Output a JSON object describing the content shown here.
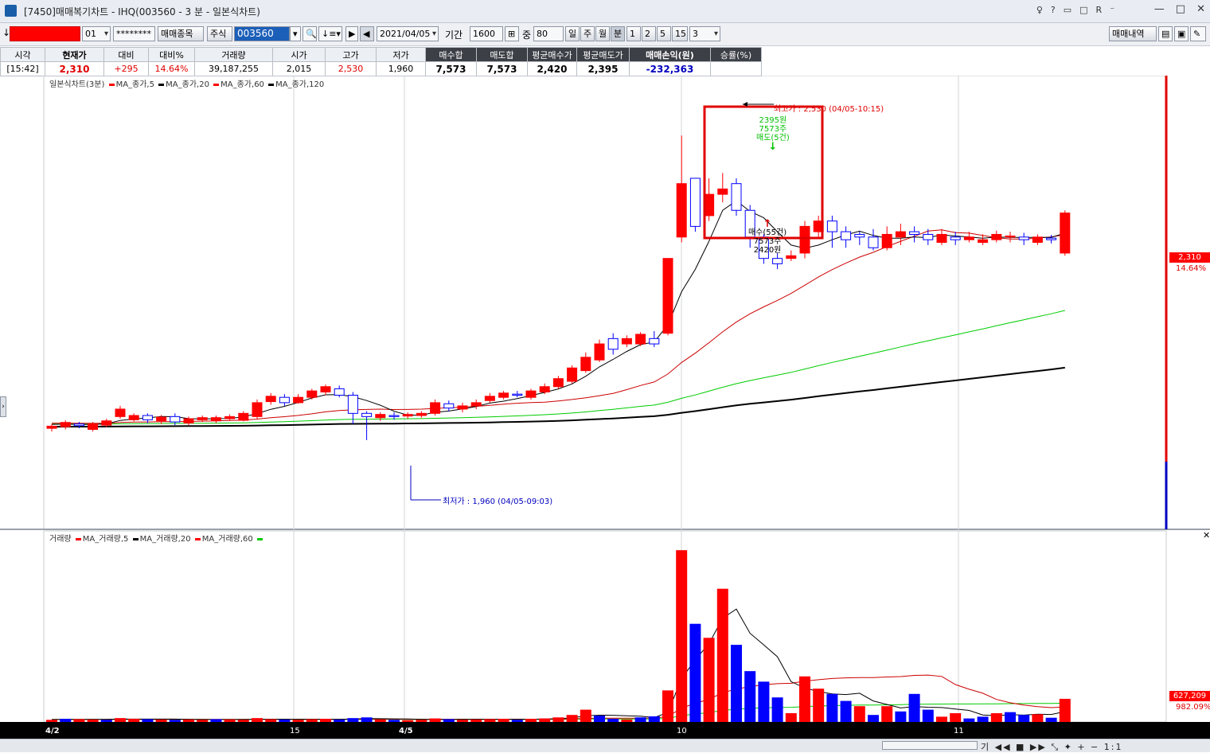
{
  "window": {
    "title": "[7450]매매복기차트 - IHQ(003560 - 3 분 - 일본식차트)",
    "small_buttons": [
      "♀",
      "?",
      "▭",
      "□",
      "R",
      "⁻"
    ],
    "controls": [
      "—",
      "□",
      "✕"
    ]
  },
  "toolbar": {
    "left_arrow": "↓",
    "account_suffix": "01",
    "password": "********",
    "trade_items_btn": "매매종목",
    "market": "주식",
    "code": "003560",
    "date": "2021/04/05",
    "period_label": "기간",
    "period_value": "1600",
    "mid_label": "중",
    "mid_value": "80",
    "tf_day": "일",
    "tf_week": "주",
    "tf_month": "월",
    "tf_min": "분",
    "tf_1": "1",
    "tf_2": "2",
    "tf_5": "5",
    "tf_15": "15",
    "tf_custom": "3",
    "history_btn": "매매내역"
  },
  "summary": {
    "headers": [
      "시각",
      "현재가",
      "대비",
      "대비%",
      "거래량",
      "시가",
      "고가",
      "저가",
      "매수합",
      "매도합",
      "평균매수가",
      "평균매도가",
      "매매손익(원)",
      "승률(%)"
    ],
    "values": [
      "[15:42]",
      "2,310",
      "+295",
      "14.64%",
      "39,187,255",
      "2,015",
      "2,530",
      "1,960",
      "7,573",
      "7,573",
      "2,420",
      "2,395",
      "-232,363",
      ""
    ]
  },
  "price_panel": {
    "legend_title": "일본식차트(3분)",
    "legend": [
      {
        "name": "MA_종가,5",
        "color": "#ff0000"
      },
      {
        "name": "MA_종가,20",
        "color": "#000000"
      },
      {
        "name": "MA_종가,60",
        "color": "#ff0000"
      },
      {
        "name": "MA_종가,120",
        "color": "#000000"
      }
    ],
    "high_note": "최고가 : 2,530 (04/05-10:15)",
    "low_note": "최저가 : 1,960 (04/05-09:03)",
    "sell_marker": {
      "price": "2395원",
      "qty": "7573주",
      "label": "매도(5건)"
    },
    "buy_marker": {
      "label": "매수(55건)",
      "qty": "7573주",
      "price": "2420원"
    },
    "last_price": "2,310",
    "last_pct": "14.64%"
  },
  "volume_panel": {
    "legend_title": "거래량",
    "legend": [
      {
        "name": "MA_거래량,5",
        "color": "#ff0000"
      },
      {
        "name": "MA_거래량,20",
        "color": "#000000"
      },
      {
        "name": "MA_거래량,60",
        "color": "#ff0000"
      }
    ],
    "last_volume": "627,209",
    "last_pct": "982.09%"
  },
  "x_axis": {
    "labels": [
      {
        "text": "4/2",
        "bold": true
      },
      {
        "text": "15",
        "bold": false
      },
      {
        "text": "4/5",
        "bold": true
      },
      {
        "text": "10",
        "bold": false
      },
      {
        "text": "11",
        "bold": false
      }
    ]
  },
  "statusbar": {
    "controls": "기 ◀◀ ■ ▶▶ ⤡ ✦ + − 1:1"
  },
  "colors": {
    "up": "#ff0000",
    "down": "#0000ff",
    "ma5": "#000000",
    "ma20": "#cc0000",
    "ma60": "#00cc00",
    "ma120": "#000000"
  },
  "chart_data": {
    "type": "candlestick",
    "price_scale": {
      "min": 1860,
      "max": 2590
    },
    "candles": [
      [
        1982,
        1986,
        1976,
        1990
      ],
      [
        1985,
        1993,
        1980,
        1997
      ],
      [
        1990,
        1987,
        1982,
        1994
      ],
      [
        1980,
        1990,
        1976,
        1994
      ],
      [
        1988,
        1996,
        1984,
        2000
      ],
      [
        2004,
        2018,
        2000,
        2024
      ],
      [
        1998,
        2006,
        1995,
        2010
      ],
      [
        2006,
        1998,
        1992,
        2010
      ],
      [
        1996,
        2003,
        1990,
        2007
      ],
      [
        2004,
        1994,
        1988,
        2010
      ],
      [
        1992,
        2000,
        1988,
        2004
      ],
      [
        1998,
        2002,
        1994,
        2006
      ],
      [
        1996,
        2002,
        1992,
        2006
      ],
      [
        2000,
        2004,
        1996,
        2008
      ],
      [
        1997,
        2010,
        1995,
        2014
      ],
      [
        2004,
        2030,
        2000,
        2036
      ],
      [
        2032,
        2042,
        2026,
        2048
      ],
      [
        2040,
        2030,
        2024,
        2046
      ],
      [
        2030,
        2040,
        2028,
        2046
      ],
      [
        2040,
        2052,
        2036,
        2056
      ],
      [
        2050,
        2060,
        2044,
        2064
      ],
      [
        2056,
        2044,
        2040,
        2062
      ],
      [
        2044,
        2010,
        1990,
        2050
      ],
      [
        2010,
        2004,
        1960,
        2014
      ],
      [
        2002,
        2008,
        1996,
        2012
      ],
      [
        2006,
        2004,
        1998,
        2012
      ],
      [
        2005,
        2008,
        2000,
        2012
      ],
      [
        2006,
        2010,
        2002,
        2014
      ],
      [
        2010,
        2030,
        2006,
        2036
      ],
      [
        2028,
        2020,
        2014,
        2034
      ],
      [
        2018,
        2024,
        2012,
        2030
      ],
      [
        2024,
        2030,
        2018,
        2036
      ],
      [
        2034,
        2042,
        2030,
        2048
      ],
      [
        2040,
        2048,
        2036,
        2052
      ],
      [
        2046,
        2044,
        2040,
        2052
      ],
      [
        2040,
        2052,
        2036,
        2056
      ],
      [
        2050,
        2060,
        2046,
        2066
      ],
      [
        2060,
        2075,
        2056,
        2080
      ],
      [
        2070,
        2095,
        2066,
        2100
      ],
      [
        2090,
        2115,
        2086,
        2124
      ],
      [
        2110,
        2140,
        2106,
        2148
      ],
      [
        2150,
        2130,
        2120,
        2160
      ],
      [
        2140,
        2150,
        2134,
        2156
      ],
      [
        2140,
        2158,
        2136,
        2162
      ],
      [
        2150,
        2140,
        2134,
        2164
      ],
      [
        2160,
        2300,
        2156,
        2300
      ],
      [
        2340,
        2440,
        2330,
        2530
      ],
      [
        2450,
        2360,
        2350,
        2450
      ],
      [
        2380,
        2420,
        2370,
        2450
      ],
      [
        2420,
        2430,
        2405,
        2460
      ],
      [
        2440,
        2390,
        2380,
        2450
      ],
      [
        2390,
        2340,
        2320,
        2400
      ],
      [
        2340,
        2300,
        2290,
        2345
      ],
      [
        2300,
        2290,
        2280,
        2310
      ],
      [
        2300,
        2305,
        2295,
        2315
      ],
      [
        2310,
        2360,
        2300,
        2370
      ],
      [
        2350,
        2370,
        2340,
        2380
      ],
      [
        2370,
        2350,
        2320,
        2380
      ],
      [
        2350,
        2335,
        2320,
        2360
      ],
      [
        2345,
        2340,
        2325,
        2350
      ],
      [
        2340,
        2320,
        2315,
        2355
      ],
      [
        2320,
        2345,
        2315,
        2360
      ],
      [
        2340,
        2350,
        2325,
        2365
      ],
      [
        2350,
        2345,
        2330,
        2360
      ],
      [
        2345,
        2335,
        2325,
        2355
      ],
      [
        2330,
        2345,
        2325,
        2355
      ],
      [
        2340,
        2335,
        2325,
        2350
      ],
      [
        2335,
        2340,
        2330,
        2350
      ],
      [
        2330,
        2335,
        2325,
        2345
      ],
      [
        2335,
        2345,
        2330,
        2352
      ],
      [
        2340,
        2342,
        2330,
        2350
      ],
      [
        2340,
        2335,
        2325,
        2348
      ],
      [
        2330,
        2340,
        2325,
        2345
      ],
      [
        2338,
        2335,
        2328,
        2344
      ],
      [
        2310,
        2385,
        2305,
        2390
      ]
    ],
    "volume_scale": {
      "max": 5200000
    },
    "volumes": [
      [
        60000,
        1
      ],
      [
        90000,
        0
      ],
      [
        80000,
        1
      ],
      [
        70000,
        1
      ],
      [
        60000,
        0
      ],
      [
        110000,
        1
      ],
      [
        90000,
        1
      ],
      [
        80000,
        0
      ],
      [
        70000,
        1
      ],
      [
        60000,
        0
      ],
      [
        70000,
        1
      ],
      [
        60000,
        1
      ],
      [
        80000,
        0
      ],
      [
        70000,
        1
      ],
      [
        60000,
        1
      ],
      [
        110000,
        1
      ],
      [
        80000,
        1
      ],
      [
        70000,
        0
      ],
      [
        60000,
        1
      ],
      [
        80000,
        1
      ],
      [
        90000,
        1
      ],
      [
        70000,
        0
      ],
      [
        110000,
        0
      ],
      [
        130000,
        0
      ],
      [
        70000,
        1
      ],
      [
        60000,
        0
      ],
      [
        50000,
        1
      ],
      [
        60000,
        1
      ],
      [
        100000,
        1
      ],
      [
        80000,
        0
      ],
      [
        60000,
        1
      ],
      [
        70000,
        1
      ],
      [
        80000,
        1
      ],
      [
        90000,
        1
      ],
      [
        60000,
        0
      ],
      [
        90000,
        1
      ],
      [
        100000,
        1
      ],
      [
        130000,
        1
      ],
      [
        200000,
        1
      ],
      [
        350000,
        1
      ],
      [
        180000,
        0
      ],
      [
        90000,
        0
      ],
      [
        70000,
        1
      ],
      [
        130000,
        0
      ],
      [
        160000,
        0
      ],
      [
        900000,
        1
      ],
      [
        4900000,
        1
      ],
      [
        2800000,
        0
      ],
      [
        2400000,
        1
      ],
      [
        3800000,
        1
      ],
      [
        2200000,
        0
      ],
      [
        1450000,
        0
      ],
      [
        1150000,
        0
      ],
      [
        700000,
        0
      ],
      [
        250000,
        1
      ],
      [
        1300000,
        1
      ],
      [
        950000,
        1
      ],
      [
        800000,
        0
      ],
      [
        600000,
        0
      ],
      [
        450000,
        1
      ],
      [
        200000,
        0
      ],
      [
        450000,
        1
      ],
      [
        300000,
        0
      ],
      [
        800000,
        0
      ],
      [
        350000,
        0
      ],
      [
        150000,
        1
      ],
      [
        250000,
        1
      ],
      [
        100000,
        0
      ],
      [
        150000,
        0
      ],
      [
        250000,
        1
      ],
      [
        280000,
        0
      ],
      [
        200000,
        0
      ],
      [
        220000,
        1
      ],
      [
        120000,
        0
      ],
      [
        660000,
        1
      ]
    ]
  }
}
